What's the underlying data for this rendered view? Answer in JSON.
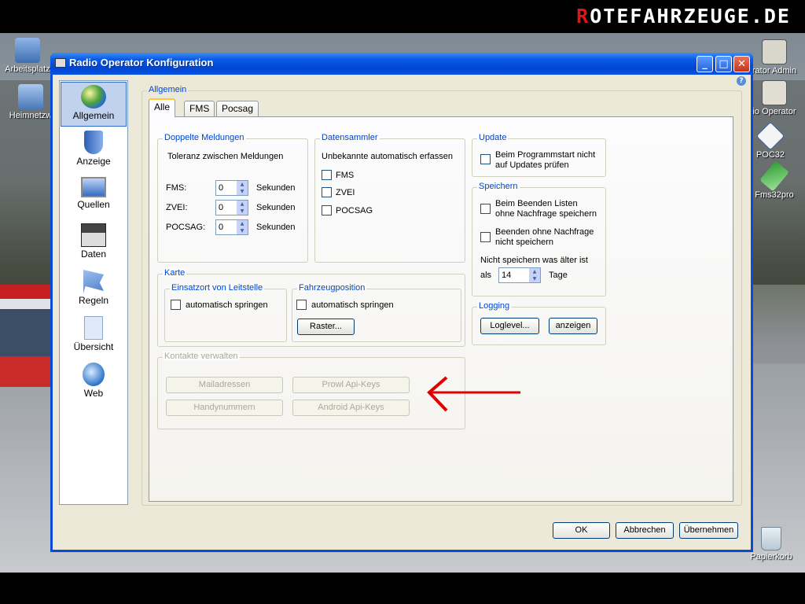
{
  "desktop": {
    "brand_first": "R",
    "brand_rest": "OTEFAHRZEUGE.DE",
    "icons_left": [
      {
        "label": "Arbeitsplatz",
        "icon": "computer-icon"
      },
      {
        "label": "Heimnetzw",
        "icon": "network-icon"
      }
    ],
    "icons_right": [
      {
        "label": "rator Admin",
        "icon": "app-icon"
      },
      {
        "label": "io Operator",
        "icon": "radio-icon"
      },
      {
        "label": "POC32",
        "icon": "poc32-icon"
      },
      {
        "label": "Fms32pro",
        "icon": "fms32-icon"
      },
      {
        "label": "Papierkorb",
        "icon": "recycle-bin-icon"
      }
    ]
  },
  "window": {
    "title": "Radio Operator Konfiguration",
    "buttons": {
      "minimize": "_",
      "maximize": "□",
      "close": "✕"
    }
  },
  "sidebar": {
    "items": [
      {
        "label": "Allgemein",
        "icon": "globe-icon",
        "active": true
      },
      {
        "label": "Anzeige",
        "icon": "shield-icon",
        "active": false
      },
      {
        "label": "Quellen",
        "icon": "monitor-icon",
        "active": false
      },
      {
        "label": "Daten",
        "icon": "floppy-icon",
        "active": false
      },
      {
        "label": "Regeln",
        "icon": "flag-icon",
        "active": false
      },
      {
        "label": "Übersicht",
        "icon": "document-icon",
        "active": false
      },
      {
        "label": "Web",
        "icon": "web-icon",
        "active": false
      }
    ]
  },
  "main": {
    "group_title": "Allgemein",
    "tabs": [
      {
        "label": "Alle",
        "active": true
      },
      {
        "label": "FMS",
        "active": false
      },
      {
        "label": "Pocsag",
        "active": false
      }
    ],
    "doppelte": {
      "title": "Doppelte Meldungen",
      "description": "Toleranz zwischen Meldungen",
      "rows": [
        {
          "label": "FMS:",
          "value": "0",
          "unit": "Sekunden"
        },
        {
          "label": "ZVEI:",
          "value": "0",
          "unit": "Sekunden"
        },
        {
          "label": "POCSAG:",
          "value": "0",
          "unit": "Sekunden"
        }
      ]
    },
    "datensammler": {
      "title": "Datensammler",
      "description": "Unbekannte automatisch erfassen",
      "options": [
        "FMS",
        "ZVEI",
        "POCSAG"
      ]
    },
    "update": {
      "title": "Update",
      "option_line1": "Beim Programmstart nicht",
      "option_line2": "auf Updates prüfen"
    },
    "speichern": {
      "title": "Speichern",
      "opt1_line1": "Beim Beenden Listen",
      "opt1_line2": "ohne Nachfrage speichern",
      "opt2_line1": "Beenden ohne Nachfrage",
      "opt2_line2": "nicht speichern",
      "keep_label": "Nicht speichern was älter ist",
      "als": "als",
      "days_value": "14",
      "days_unit": "Tage"
    },
    "karte": {
      "title": "Karte",
      "einsatzort_title": "Einsatzort von Leitstelle",
      "einsatzort_option": "automatisch springen",
      "fahrzeug_title": "Fahrzeugposition",
      "fahrzeug_option": "automatisch springen",
      "raster_button": "Raster..."
    },
    "logging": {
      "title": "Logging",
      "loglevel_button": "Loglevel...",
      "anzeigen_button": "anzeigen"
    },
    "kontakte": {
      "title": "Kontakte verwalten",
      "mail_button": "Mailadressen",
      "prowl_button": "Prowl Api-Keys",
      "handy_button": "Handynummern",
      "android_button": "Android Api-Keys"
    }
  },
  "footer": {
    "ok": "OK",
    "abbrechen": "Abbrechen",
    "uebernehmen": "Übernehmen"
  },
  "colors": {
    "accent": "#0046d5",
    "arrow": "#e00000",
    "panel": "#ece9d8"
  }
}
